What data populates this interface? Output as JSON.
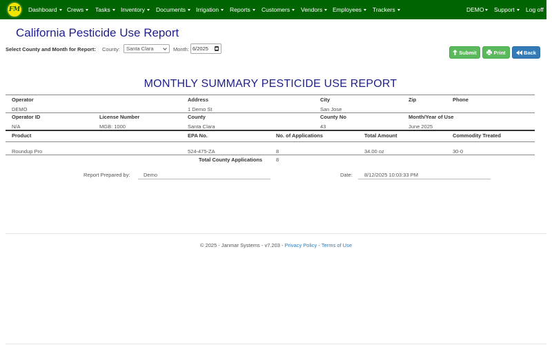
{
  "nav": {
    "logo_text": "FM",
    "items": [
      {
        "label": "Dashboard"
      },
      {
        "label": "Crews"
      },
      {
        "label": "Tasks"
      },
      {
        "label": "Inventory"
      },
      {
        "label": "Documents"
      },
      {
        "label": "Irrigation"
      },
      {
        "label": "Reports"
      },
      {
        "label": "Customers"
      },
      {
        "label": "Vendors"
      },
      {
        "label": "Employees"
      },
      {
        "label": "Trackers"
      }
    ],
    "right": [
      {
        "label": "DEMO"
      },
      {
        "label": "Support"
      },
      {
        "label": "Log off"
      }
    ]
  },
  "page": {
    "title": "California Pesticide Use Report"
  },
  "filters": {
    "label": "Select County and Month for Report:",
    "county_label": "County:",
    "county_value": "Santa Clara",
    "month_label": "Month:",
    "month_value": "6/2025"
  },
  "buttons": {
    "submit": "Submit",
    "print": "Print",
    "back": "Back"
  },
  "report": {
    "title": "MONTHLY SUMMARY PESTICIDE USE REPORT",
    "row1_headers": [
      "Operator",
      "Address",
      "City",
      "Zip",
      "Phone"
    ],
    "row1_values": [
      "DEMO",
      "1 Demo St",
      "San Jose",
      "",
      ""
    ],
    "row2_headers": [
      "Operator ID",
      "License Number",
      "County",
      "County No",
      "Month/Year of Use"
    ],
    "row2_values": [
      "N/A",
      "MGB: 1000",
      "Santa Clara",
      "43",
      "June 2025"
    ],
    "product_headers": [
      "Product",
      "EPA No.",
      "No. of Applications",
      "Total Amount",
      "Commodity Treated"
    ],
    "products": [
      {
        "product": "Roundup Pro",
        "epa": "524-475-ZA",
        "applications": "8",
        "amount": "34.00 oz",
        "commodity": "30-0"
      }
    ],
    "total_label": "Total County Applications",
    "total_value": "8"
  },
  "prepared": {
    "label": "Report Prepared by:",
    "value": "Demo",
    "date_label": "Date:",
    "date_value": "8/12/2025 10:03:33 PM"
  },
  "footer": {
    "text": "© 2025 - Janmar Systems - v7.203 - ",
    "privacy": "Privacy Policy",
    "sep": " - ",
    "terms": "Terms of Use"
  }
}
